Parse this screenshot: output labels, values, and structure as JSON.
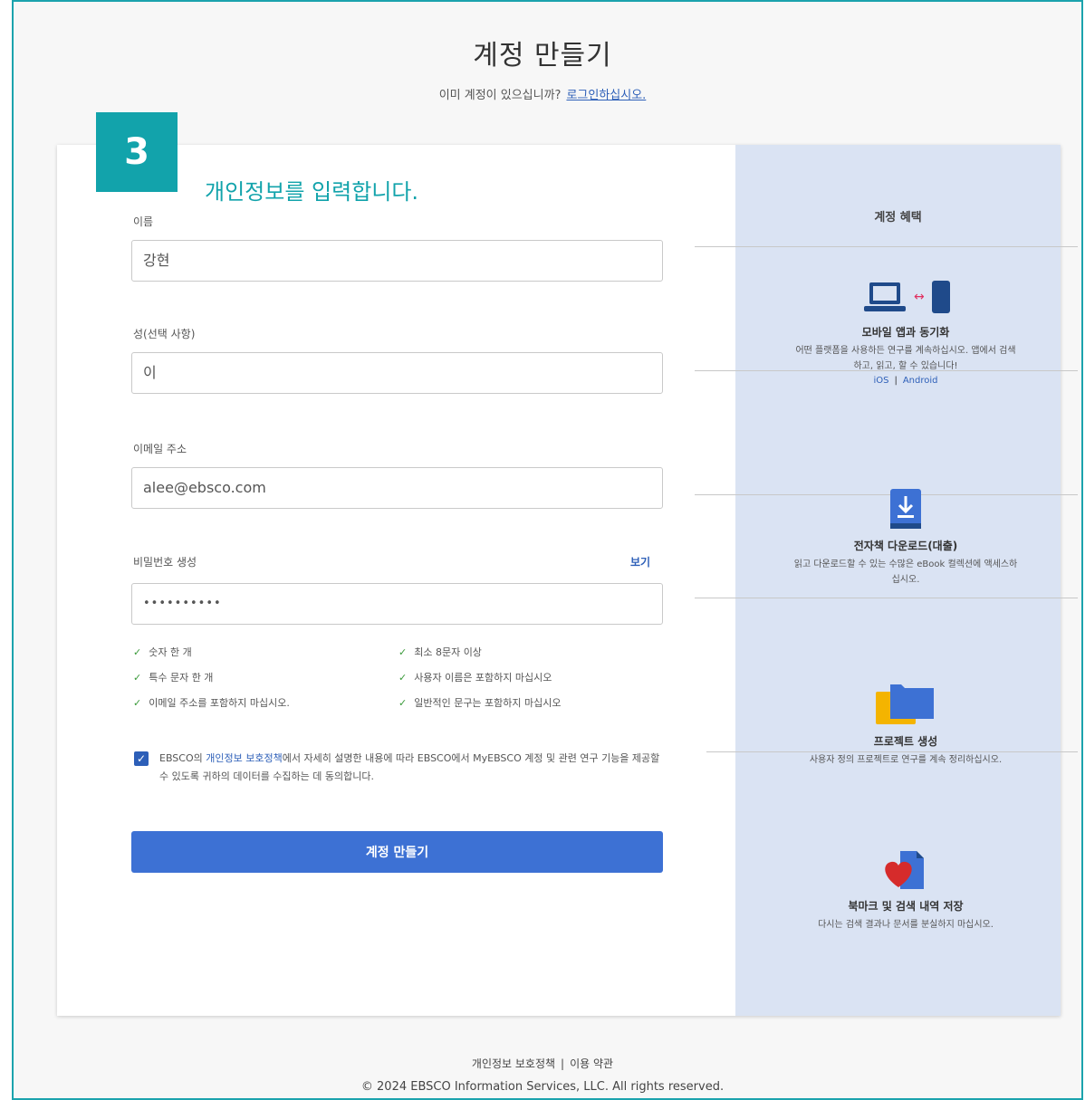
{
  "page": {
    "title": "계정 만들기",
    "subtitle_text": "이미 계정이 있으십니까?",
    "subtitle_link": "로그인하십시오."
  },
  "annotation": {
    "step_number": "3",
    "note": "개인정보를 입력합니다."
  },
  "form": {
    "first_name_label": "이름",
    "first_name_value": "강현",
    "last_name_label": "성(선택 사항)",
    "last_name_value": "이",
    "email_label": "이메일 주소",
    "email_value": "alee@ebsco.com",
    "password_label": "비밀번호 생성",
    "password_show": "보기",
    "password_value": "••••••••••",
    "rules": [
      "숫자 한 개",
      "특수 문자 한 개",
      "이메일 주소를 포함하지 마십시오.",
      "최소 8문자 이상",
      "사용자 이름은 포함하지 마십시오",
      "일반적인 문구는 포함하지 마십시오"
    ],
    "consent_checkmark": "✓",
    "consent_before": "EBSCO의",
    "consent_link": "개인정보 보호정책",
    "consent_after": "에서 자세히 설명한 내용에 따라 EBSCO에서 MyEBSCO 계정 및 관련 연구 기능을 제공할 수 있도록 귀하의 데이터를 수집하는 데 동의합니다.",
    "submit_label": "계정 만들기"
  },
  "benefits": {
    "title": "계정 혜택",
    "items": [
      {
        "icon": "device-sync-icon",
        "title": "모바일 앱과 동기화",
        "desc": "어떤 플랫폼을 사용하든 연구를 계속하십시오. 앱에서 검색하고, 읽고, 할 수 있습니다!",
        "link_ios": "iOS",
        "link_sep": "|",
        "link_android": "Android"
      },
      {
        "icon": "download-icon",
        "title": "전자책 다운로드(대출)",
        "desc": "읽고 다운로드할 수 있는 수많은 eBook 컬렉션에 액세스하십시오."
      },
      {
        "icon": "folder-icon",
        "title": "프로젝트 생성",
        "desc": "사용자 정의 프로젝트로 연구를 계속 정리하십시오."
      },
      {
        "icon": "bookmark-heart-icon",
        "title": "북마크 및 검색 내역 저장",
        "desc": "다시는 검색 결과나 문서를 분실하지 마십시오."
      }
    ]
  },
  "footer": {
    "privacy": "개인정보 보호정책",
    "sep": "|",
    "terms": "이용 약관",
    "copyright": "© 2024 EBSCO Information Services, LLC. All rights reserved."
  },
  "colors": {
    "accent": "#12a3ab",
    "primary": "#3d71d4",
    "panel": "#dae3f3"
  }
}
